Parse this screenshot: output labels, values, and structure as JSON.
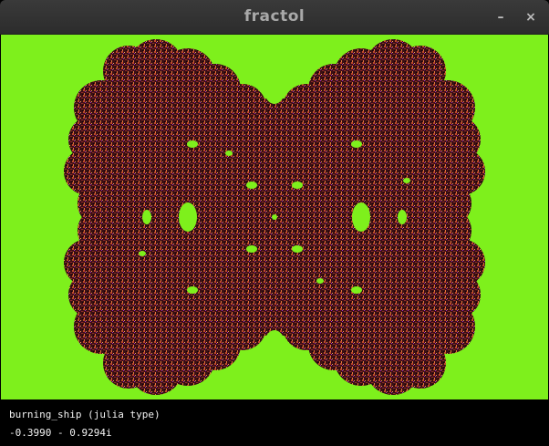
{
  "window": {
    "title": "fractol",
    "minimize_glyph": "–",
    "close_glyph": "×"
  },
  "canvas": {
    "background_color": "#7ef01c",
    "fractal_colors": [
      "#3a0f14",
      "#5c1a1f",
      "#8e2a2a",
      "#c0472c",
      "#e27a3c",
      "#f0a050",
      "#b02ad0",
      "#120408"
    ]
  },
  "status": {
    "fractal_label": "burning_ship (julia type)",
    "complex_param": "-0.3990 - 0.9294i"
  }
}
